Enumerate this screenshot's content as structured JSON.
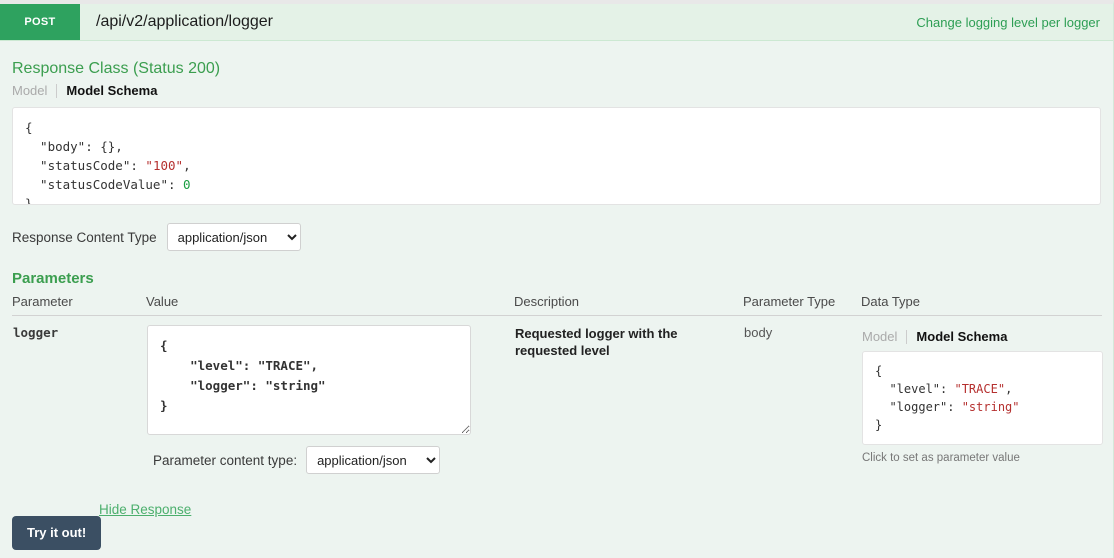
{
  "operation": {
    "method": "POST",
    "path": "/api/v2/application/logger",
    "summary": "Change logging level per logger"
  },
  "response_class": {
    "title": "Response Class (Status 200)",
    "tabs": {
      "model": "Model",
      "model_schema": "Model Schema"
    },
    "schema_lines": [
      {
        "plain": "{"
      },
      {
        "plain": "  \"body\": {},"
      },
      {
        "pre": "  \"statusCode\": ",
        "str": "\"100\"",
        "post": ","
      },
      {
        "pre": "  \"statusCodeValue\": ",
        "num": "0"
      },
      {
        "plain": "}"
      }
    ],
    "content_type_label": "Response Content Type",
    "content_type_value": "application/json",
    "content_type_options": [
      "application/json"
    ]
  },
  "parameters": {
    "title": "Parameters",
    "headers": {
      "parameter": "Parameter",
      "value": "Value",
      "description": "Description",
      "parameter_type": "Parameter Type",
      "data_type": "Data Type"
    },
    "rows": [
      {
        "name": "logger",
        "value": "{\n    \"level\": \"TRACE\",\n    \"logger\": \"string\"\n}",
        "description": "Requested logger with the requested level",
        "parameter_type": "body",
        "data_type": {
          "tabs": {
            "model": "Model",
            "model_schema": "Model Schema"
          },
          "schema_lines": [
            {
              "plain": "{"
            },
            {
              "pre": "  \"level\": ",
              "str": "\"TRACE\"",
              "post": ","
            },
            {
              "pre": "  \"logger\": ",
              "str": "\"string\""
            },
            {
              "plain": "}"
            }
          ],
          "hint": "Click to set as parameter value"
        }
      }
    ],
    "param_content_type_label": "Parameter content type:",
    "param_content_type_value": "application/json",
    "param_content_type_options": [
      "application/json"
    ]
  },
  "footer": {
    "submit_label": "Try it out!",
    "hide_response_label": "Hide Response"
  },
  "colors": {
    "method_green": "#2ea25f",
    "heading_green": "#3b9e4f",
    "link_green": "#2d9e54",
    "submit_slate": "#3b4f63",
    "page_bg": "#edf4f0",
    "header_bg": "#e4f2e7",
    "string_red": "#b5302f",
    "number_green": "#1a9e41"
  }
}
